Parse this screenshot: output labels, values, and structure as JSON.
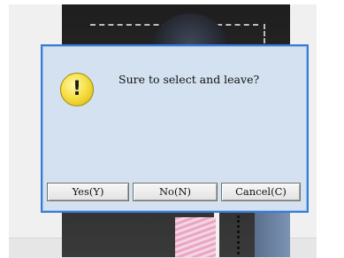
{
  "dialog": {
    "message": "Sure to select and leave?",
    "icon": "warning-icon",
    "icon_glyph": "!",
    "buttons": {
      "yes": "Yes(Y)",
      "no": "No(N)",
      "cancel": "Cancel(C)"
    },
    "colors": {
      "background": "#d3e1f0",
      "border": "#3a7bd5",
      "icon": "#f7e04a"
    }
  }
}
